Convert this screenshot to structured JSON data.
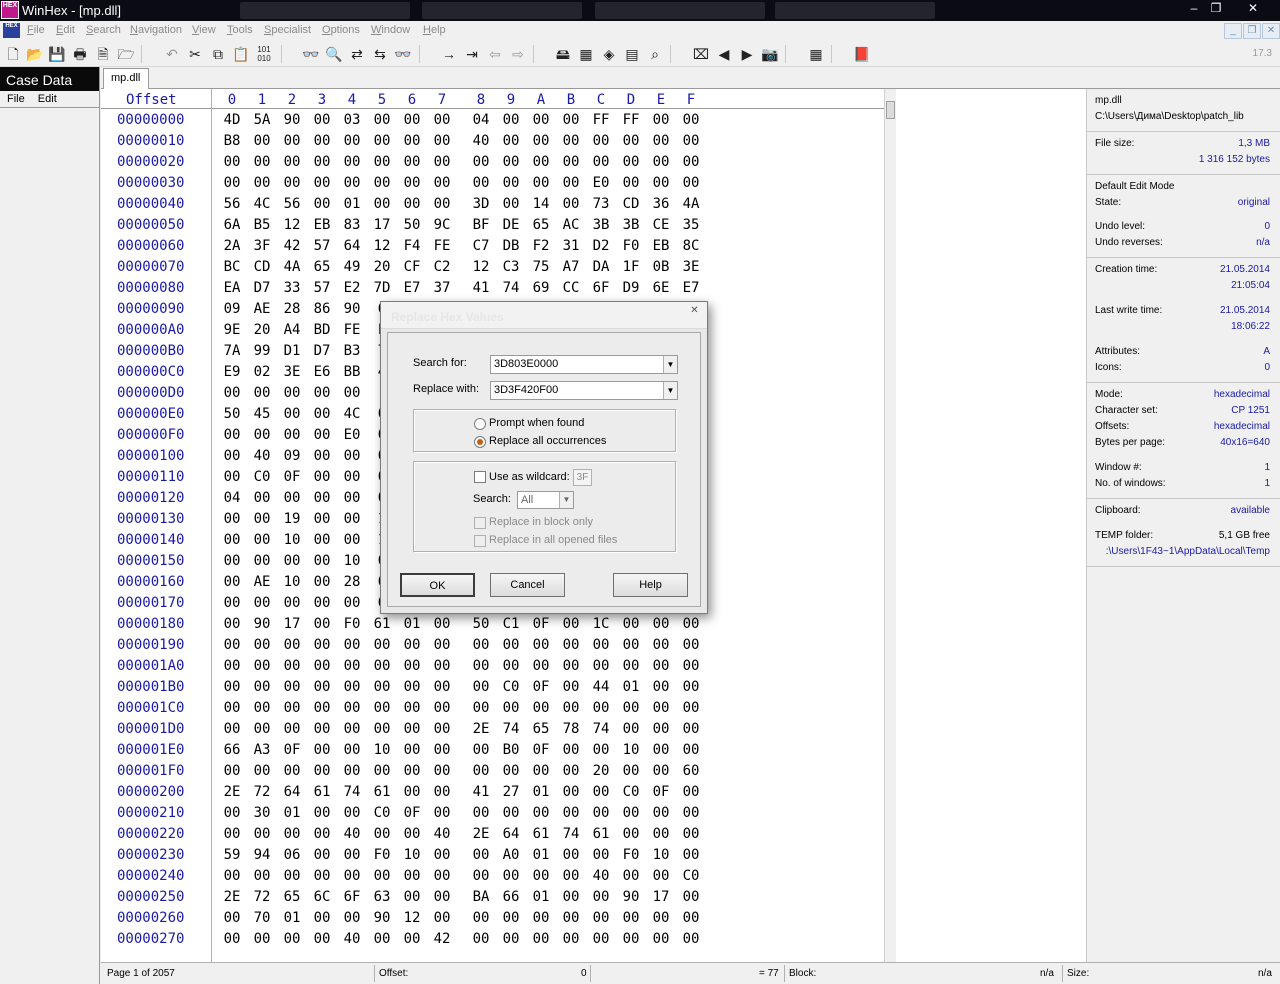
{
  "window": {
    "title": "WinHex - [mp.dll]",
    "version": "17.3",
    "app_logo_text": "HEX"
  },
  "menu": [
    "File",
    "Edit",
    "Search",
    "Navigation",
    "View",
    "Tools",
    "Specialist",
    "Options",
    "Window",
    "Help"
  ],
  "case_panel": {
    "title": "Case Data",
    "menu": [
      "File",
      "Edit"
    ]
  },
  "tab": {
    "label": "mp.dll"
  },
  "hex_view": {
    "offset_label": "Offset",
    "columns": [
      "0",
      "1",
      "2",
      "3",
      "4",
      "5",
      "6",
      "7",
      "8",
      "9",
      "A",
      "B",
      "C",
      "D",
      "E",
      "F"
    ],
    "rows": [
      {
        "offset": "00000000",
        "bytes": [
          "4D",
          "5A",
          "90",
          "00",
          "03",
          "00",
          "00",
          "00",
          "04",
          "00",
          "00",
          "00",
          "FF",
          "FF",
          "00",
          "00"
        ]
      },
      {
        "offset": "00000010",
        "bytes": [
          "B8",
          "00",
          "00",
          "00",
          "00",
          "00",
          "00",
          "00",
          "40",
          "00",
          "00",
          "00",
          "00",
          "00",
          "00",
          "00"
        ]
      },
      {
        "offset": "00000020",
        "bytes": [
          "00",
          "00",
          "00",
          "00",
          "00",
          "00",
          "00",
          "00",
          "00",
          "00",
          "00",
          "00",
          "00",
          "00",
          "00",
          "00"
        ]
      },
      {
        "offset": "00000030",
        "bytes": [
          "00",
          "00",
          "00",
          "00",
          "00",
          "00",
          "00",
          "00",
          "00",
          "00",
          "00",
          "00",
          "E0",
          "00",
          "00",
          "00"
        ]
      },
      {
        "offset": "00000040",
        "bytes": [
          "56",
          "4C",
          "56",
          "00",
          "01",
          "00",
          "00",
          "00",
          "3D",
          "00",
          "14",
          "00",
          "73",
          "CD",
          "36",
          "4A"
        ]
      },
      {
        "offset": "00000050",
        "bytes": [
          "6A",
          "B5",
          "12",
          "EB",
          "83",
          "17",
          "50",
          "9C",
          "BF",
          "DE",
          "65",
          "AC",
          "3B",
          "3B",
          "CE",
          "35"
        ]
      },
      {
        "offset": "00000060",
        "bytes": [
          "2A",
          "3F",
          "42",
          "57",
          "64",
          "12",
          "F4",
          "FE",
          "C7",
          "DB",
          "F2",
          "31",
          "D2",
          "F0",
          "EB",
          "8C"
        ]
      },
      {
        "offset": "00000070",
        "bytes": [
          "BC",
          "CD",
          "4A",
          "65",
          "49",
          "20",
          "CF",
          "C2",
          "12",
          "C3",
          "75",
          "A7",
          "DA",
          "1F",
          "0B",
          "3E"
        ]
      },
      {
        "offset": "00000080",
        "bytes": [
          "EA",
          "D7",
          "33",
          "57",
          "E2",
          "7D",
          "E7",
          "37",
          "41",
          "74",
          "69",
          "CC",
          "6F",
          "D9",
          "6E",
          "E7"
        ]
      },
      {
        "offset": "00000090",
        "bytes": [
          "09",
          "AE",
          "28",
          "86",
          "90",
          "6",
          "",
          "",
          "",
          "",
          "",
          "",
          "",
          "",
          "",
          ""
        ]
      },
      {
        "offset": "000000A0",
        "bytes": [
          "9E",
          "20",
          "A4",
          "BD",
          "FE",
          "F",
          "",
          "",
          "",
          "",
          "",
          "",
          "",
          "",
          "",
          ""
        ]
      },
      {
        "offset": "000000B0",
        "bytes": [
          "7A",
          "99",
          "D1",
          "D7",
          "B3",
          "7",
          "",
          "",
          "",
          "",
          "",
          "",
          "",
          "",
          "",
          ""
        ]
      },
      {
        "offset": "000000C0",
        "bytes": [
          "E9",
          "02",
          "3E",
          "E6",
          "BB",
          "4",
          "",
          "",
          "",
          "",
          "",
          "",
          "",
          "",
          "",
          ""
        ]
      },
      {
        "offset": "000000D0",
        "bytes": [
          "00",
          "00",
          "00",
          "00",
          "00",
          "",
          "",
          "",
          "",
          "",
          "",
          "",
          "",
          "",
          "",
          ""
        ]
      },
      {
        "offset": "000000E0",
        "bytes": [
          "50",
          "45",
          "00",
          "00",
          "4C",
          "0",
          "",
          "",
          "",
          "",
          "",
          "",
          "",
          "",
          "",
          ""
        ]
      },
      {
        "offset": "000000F0",
        "bytes": [
          "00",
          "00",
          "00",
          "00",
          "E0",
          "0",
          "",
          "",
          "",
          "",
          "",
          "",
          "",
          "",
          "",
          ""
        ]
      },
      {
        "offset": "00000100",
        "bytes": [
          "00",
          "40",
          "09",
          "00",
          "00",
          "0",
          "",
          "",
          "",
          "",
          "",
          "",
          "",
          "",
          "",
          ""
        ]
      },
      {
        "offset": "00000110",
        "bytes": [
          "00",
          "C0",
          "0F",
          "00",
          "00",
          "0",
          "",
          "",
          "",
          "",
          "",
          "",
          "",
          "",
          "",
          ""
        ]
      },
      {
        "offset": "00000120",
        "bytes": [
          "04",
          "00",
          "00",
          "00",
          "00",
          "0",
          "",
          "",
          "",
          "",
          "",
          "",
          "",
          "",
          "",
          ""
        ]
      },
      {
        "offset": "00000130",
        "bytes": [
          "00",
          "00",
          "19",
          "00",
          "00",
          "1",
          "",
          "",
          "",
          "",
          "",
          "",
          "",
          "",
          "",
          ""
        ]
      },
      {
        "offset": "00000140",
        "bytes": [
          "00",
          "00",
          "10",
          "00",
          "00",
          "1",
          "",
          "",
          "",
          "",
          "",
          "",
          "",
          "",
          "",
          ""
        ]
      },
      {
        "offset": "00000150",
        "bytes": [
          "00",
          "00",
          "00",
          "00",
          "10",
          "0",
          "",
          "",
          "",
          "",
          "",
          "",
          "",
          "",
          "",
          ""
        ]
      },
      {
        "offset": "00000160",
        "bytes": [
          "00",
          "AE",
          "10",
          "00",
          "28",
          "0",
          "",
          "",
          "",
          "",
          "",
          "",
          "",
          "",
          "",
          ""
        ]
      },
      {
        "offset": "00000170",
        "bytes": [
          "00",
          "00",
          "00",
          "00",
          "00",
          "0",
          "",
          "",
          "",
          "",
          "",
          "",
          "",
          "",
          "",
          ""
        ]
      },
      {
        "offset": "00000180",
        "bytes": [
          "00",
          "90",
          "17",
          "00",
          "F0",
          "61",
          "01",
          "00",
          "50",
          "C1",
          "0F",
          "00",
          "1C",
          "00",
          "00",
          "00"
        ]
      },
      {
        "offset": "00000190",
        "bytes": [
          "00",
          "00",
          "00",
          "00",
          "00",
          "00",
          "00",
          "00",
          "00",
          "00",
          "00",
          "00",
          "00",
          "00",
          "00",
          "00"
        ]
      },
      {
        "offset": "000001A0",
        "bytes": [
          "00",
          "00",
          "00",
          "00",
          "00",
          "00",
          "00",
          "00",
          "00",
          "00",
          "00",
          "00",
          "00",
          "00",
          "00",
          "00"
        ]
      },
      {
        "offset": "000001B0",
        "bytes": [
          "00",
          "00",
          "00",
          "00",
          "00",
          "00",
          "00",
          "00",
          "00",
          "C0",
          "0F",
          "00",
          "44",
          "01",
          "00",
          "00"
        ]
      },
      {
        "offset": "000001C0",
        "bytes": [
          "00",
          "00",
          "00",
          "00",
          "00",
          "00",
          "00",
          "00",
          "00",
          "00",
          "00",
          "00",
          "00",
          "00",
          "00",
          "00"
        ]
      },
      {
        "offset": "000001D0",
        "bytes": [
          "00",
          "00",
          "00",
          "00",
          "00",
          "00",
          "00",
          "00",
          "2E",
          "74",
          "65",
          "78",
          "74",
          "00",
          "00",
          "00"
        ]
      },
      {
        "offset": "000001E0",
        "bytes": [
          "66",
          "A3",
          "0F",
          "00",
          "00",
          "10",
          "00",
          "00",
          "00",
          "B0",
          "0F",
          "00",
          "00",
          "10",
          "00",
          "00"
        ]
      },
      {
        "offset": "000001F0",
        "bytes": [
          "00",
          "00",
          "00",
          "00",
          "00",
          "00",
          "00",
          "00",
          "00",
          "00",
          "00",
          "00",
          "20",
          "00",
          "00",
          "60"
        ]
      },
      {
        "offset": "00000200",
        "bytes": [
          "2E",
          "72",
          "64",
          "61",
          "74",
          "61",
          "00",
          "00",
          "41",
          "27",
          "01",
          "00",
          "00",
          "C0",
          "0F",
          "00"
        ]
      },
      {
        "offset": "00000210",
        "bytes": [
          "00",
          "30",
          "01",
          "00",
          "00",
          "C0",
          "0F",
          "00",
          "00",
          "00",
          "00",
          "00",
          "00",
          "00",
          "00",
          "00"
        ]
      },
      {
        "offset": "00000220",
        "bytes": [
          "00",
          "00",
          "00",
          "00",
          "40",
          "00",
          "00",
          "40",
          "2E",
          "64",
          "61",
          "74",
          "61",
          "00",
          "00",
          "00"
        ]
      },
      {
        "offset": "00000230",
        "bytes": [
          "59",
          "94",
          "06",
          "00",
          "00",
          "F0",
          "10",
          "00",
          "00",
          "A0",
          "01",
          "00",
          "00",
          "F0",
          "10",
          "00"
        ]
      },
      {
        "offset": "00000240",
        "bytes": [
          "00",
          "00",
          "00",
          "00",
          "00",
          "00",
          "00",
          "00",
          "00",
          "00",
          "00",
          "00",
          "40",
          "00",
          "00",
          "C0"
        ]
      },
      {
        "offset": "00000250",
        "bytes": [
          "2E",
          "72",
          "65",
          "6C",
          "6F",
          "63",
          "00",
          "00",
          "BA",
          "66",
          "01",
          "00",
          "00",
          "90",
          "17",
          "00"
        ]
      },
      {
        "offset": "00000260",
        "bytes": [
          "00",
          "70",
          "01",
          "00",
          "00",
          "90",
          "12",
          "00",
          "00",
          "00",
          "00",
          "00",
          "00",
          "00",
          "00",
          "00"
        ]
      },
      {
        "offset": "00000270",
        "bytes": [
          "00",
          "00",
          "00",
          "00",
          "40",
          "00",
          "00",
          "42",
          "00",
          "00",
          "00",
          "00",
          "00",
          "00",
          "00",
          "00"
        ]
      }
    ]
  },
  "info_panel": {
    "file_name": "mp.dll",
    "file_path": "C:\\Users\\Дима\\Desktop\\patch_lib",
    "file_size_label": "File size:",
    "file_size": "1,3 MB",
    "file_size_bytes": "1 316 152 bytes",
    "edit_mode": "Default Edit Mode",
    "state_label": "State:",
    "state": "original",
    "undo_level_label": "Undo level:",
    "undo_level": "0",
    "undo_reverses_label": "Undo reverses:",
    "undo_reverses": "n/a",
    "creation_time_label": "Creation time:",
    "creation_date": "21.05.2014",
    "creation_time": "21:05:04",
    "last_write_label": "Last write time:",
    "last_write_date": "21.05.2014",
    "last_write_time": "18:06:22",
    "attributes_label": "Attributes:",
    "attributes": "A",
    "icons_label": "Icons:",
    "icons": "0",
    "mode_label": "Mode:",
    "mode": "hexadecimal",
    "charset_label": "Character set:",
    "charset": "CP 1251",
    "offsets_label": "Offsets:",
    "offsets": "hexadecimal",
    "bytes_per_page_label": "Bytes per page:",
    "bytes_per_page": "40x16=640",
    "window_num_label": "Window #:",
    "window_num": "1",
    "num_windows_label": "No. of windows:",
    "num_windows": "1",
    "clipboard_label": "Clipboard:",
    "clipboard": "available",
    "temp_label": "TEMP folder:",
    "temp_free": "5,1 GB free",
    "temp_path": ":\\Users\\1F43~1\\AppData\\Local\\Temp"
  },
  "status_bar": {
    "page": "Page 1 of 2057",
    "offset_label": "Offset:",
    "offset_value": "0",
    "eq_value": "= 77",
    "block_label": "Block:",
    "block_value": "n/a",
    "size_label": "Size:",
    "size_value": "n/a"
  },
  "dialog": {
    "title": "Replace Hex Values",
    "search_for_label": "Search for:",
    "search_for_value": "3D803E0000",
    "replace_with_label": "Replace with:",
    "replace_with_value": "3D3F420F00",
    "prompt_label": "Prompt when found",
    "replace_all_label": "Replace all occurrences",
    "wildcard_label": "Use as wildcard:",
    "wildcard_value": "3F",
    "search_label": "Search:",
    "search_value": "All",
    "block_only_label": "Replace in block only",
    "all_files_label": "Replace in all opened files",
    "ok_label": "OK",
    "cancel_label": "Cancel",
    "help_label": "Help"
  }
}
